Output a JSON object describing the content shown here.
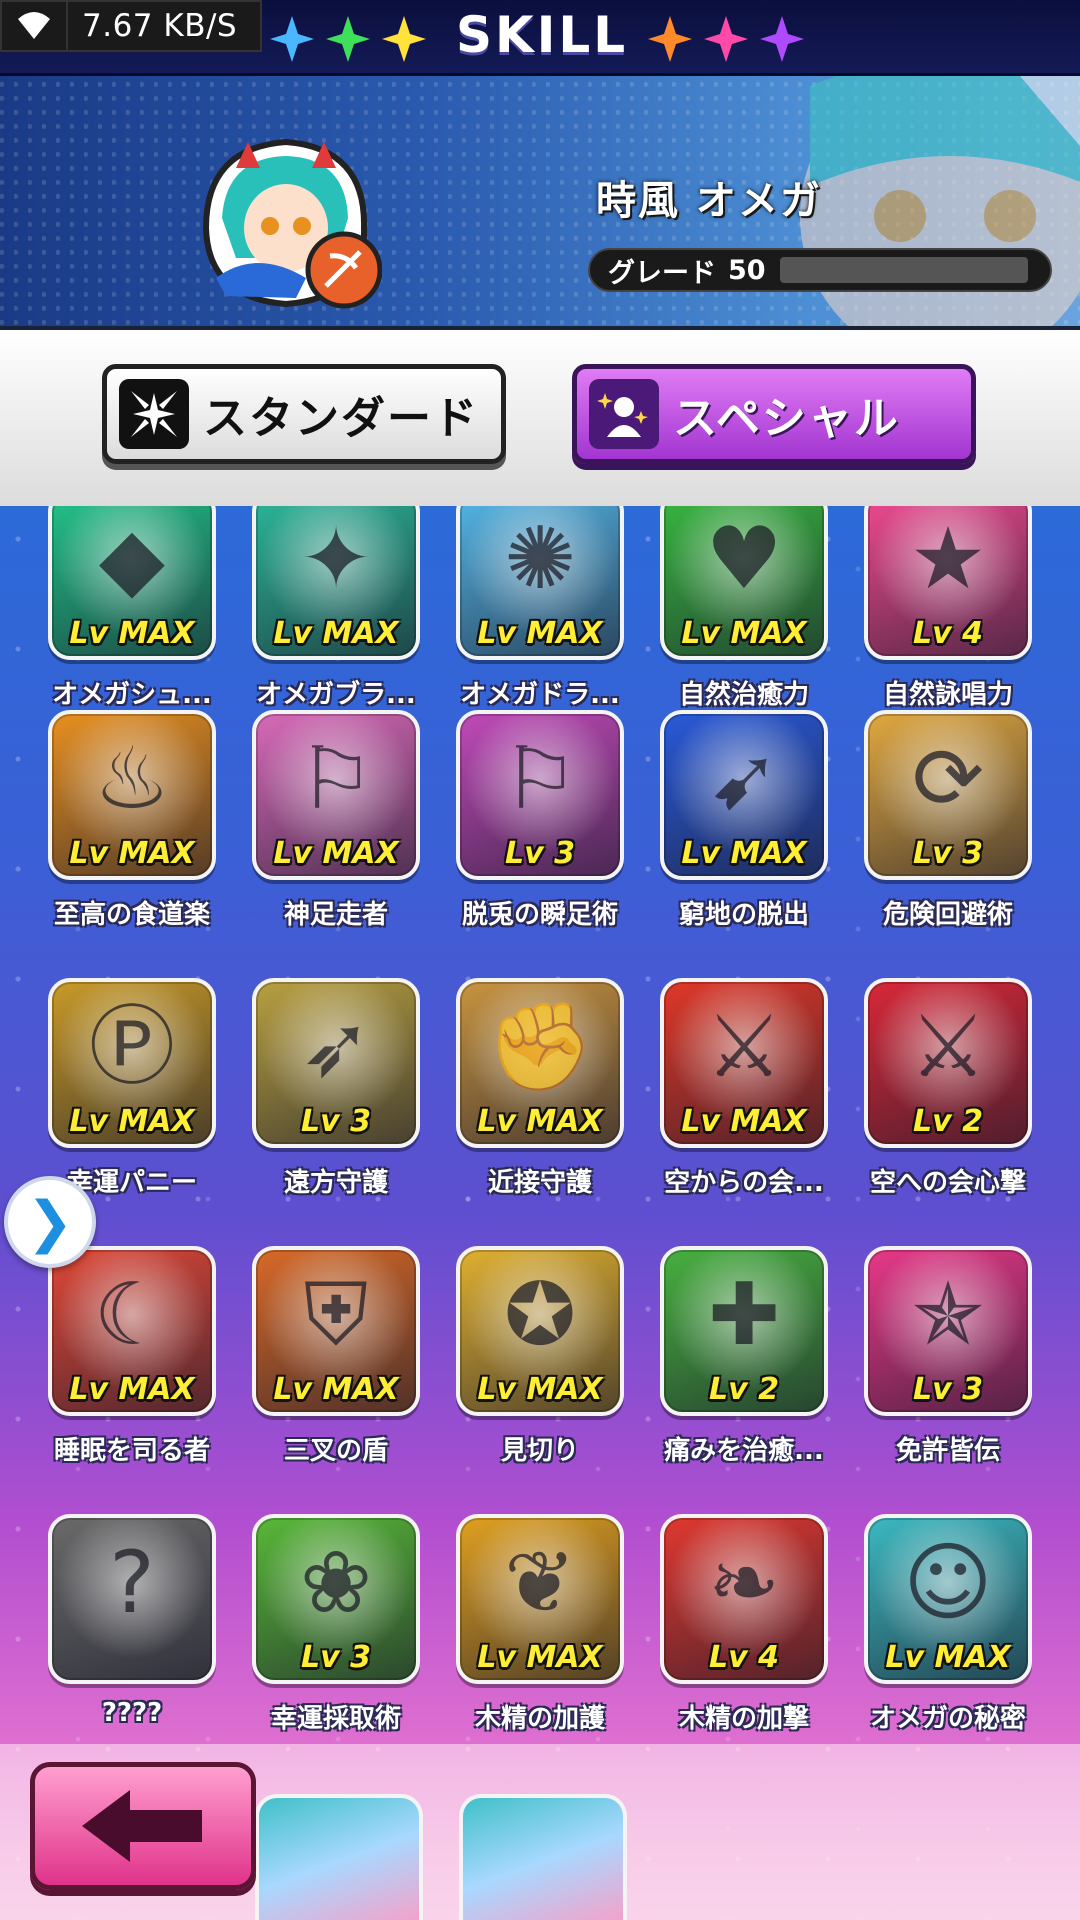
{
  "status_bar": {
    "network_speed": "7.67 KB/S"
  },
  "header": {
    "title": "SKILL"
  },
  "character": {
    "name": "時風 オメガ",
    "grade_label": "グレード",
    "grade_value": "50"
  },
  "tabs": {
    "standard_label": "スタンダード",
    "special_label": "スペシャル"
  },
  "skills": [
    {
      "name": "オメガシュ...",
      "level": "Lv MAX",
      "icon": "crystal-icon",
      "color": "#22c48a"
    },
    {
      "name": "オメガブラ...",
      "level": "Lv MAX",
      "icon": "blade-icon",
      "color": "#2bb89a"
    },
    {
      "name": "オメガドラ...",
      "level": "Lv MAX",
      "icon": "drone-icon",
      "color": "#54b6e6"
    },
    {
      "name": "自然治癒力",
      "level": "Lv MAX",
      "icon": "heart-up-icon",
      "color": "#38b840"
    },
    {
      "name": "自然詠唱力",
      "level": "Lv 4",
      "icon": "star-up-icon",
      "color": "#f04a90"
    },
    {
      "name": "至高の食道楽",
      "level": "Lv MAX",
      "icon": "fork-spoon-icon",
      "color": "#e89020"
    },
    {
      "name": "神足走者",
      "level": "Lv MAX",
      "icon": "runner-icon",
      "color": "#d86ab8"
    },
    {
      "name": "脱兎の瞬足術",
      "level": "Lv 3",
      "icon": "runner-icon",
      "color": "#c04ab8"
    },
    {
      "name": "窮地の脱出",
      "level": "Lv MAX",
      "icon": "escape-icon",
      "color": "#2a5ad8"
    },
    {
      "name": "危険回避術",
      "level": "Lv 3",
      "icon": "dodge-icon",
      "color": "#e0a840"
    },
    {
      "name": "幸運パニー",
      "level": "Lv MAX",
      "icon": "coin-icon",
      "color": "#c89a28"
    },
    {
      "name": "遠方守護",
      "level": "Lv 3",
      "icon": "arrow-shield-icon",
      "color": "#b8a040"
    },
    {
      "name": "近接守護",
      "level": "Lv MAX",
      "icon": "fist-shield-icon",
      "color": "#c89440"
    },
    {
      "name": "空からの会...",
      "level": "Lv MAX",
      "icon": "sword-jump-icon",
      "color": "#e03828"
    },
    {
      "name": "空への会心撃",
      "level": "Lv 2",
      "icon": "sword-jump-icon",
      "color": "#d82838"
    },
    {
      "name": "睡眠を司る者",
      "level": "Lv MAX",
      "icon": "sleep-icon",
      "color": "#e04838"
    },
    {
      "name": "三叉の盾",
      "level": "Lv MAX",
      "icon": "trio-shield-icon",
      "color": "#d86a28"
    },
    {
      "name": "見切り",
      "level": "Lv MAX",
      "icon": "flex-icon",
      "color": "#e0b030"
    },
    {
      "name": "痛みを治癒...",
      "level": "Lv 2",
      "icon": "heal-icon",
      "color": "#48b040"
    },
    {
      "name": "免許皆伝",
      "level": "Lv 3",
      "icon": "star-medal-icon",
      "color": "#e83888"
    },
    {
      "name": "????",
      "level": "",
      "icon": "locked-icon",
      "color": "#6a6a6a"
    },
    {
      "name": "幸運採取術",
      "level": "Lv 3",
      "icon": "lily-icon",
      "color": "#58b838"
    },
    {
      "name": "木精の加護",
      "level": "Lv MAX",
      "icon": "leaf-shield-icon",
      "color": "#e0a020"
    },
    {
      "name": "木精の加撃",
      "level": "Lv 4",
      "icon": "leaf-sword-icon",
      "color": "#e03830"
    },
    {
      "name": "オメガの秘密",
      "level": "Lv MAX",
      "icon": "portrait-icon",
      "color": "#3cb8c0"
    }
  ]
}
